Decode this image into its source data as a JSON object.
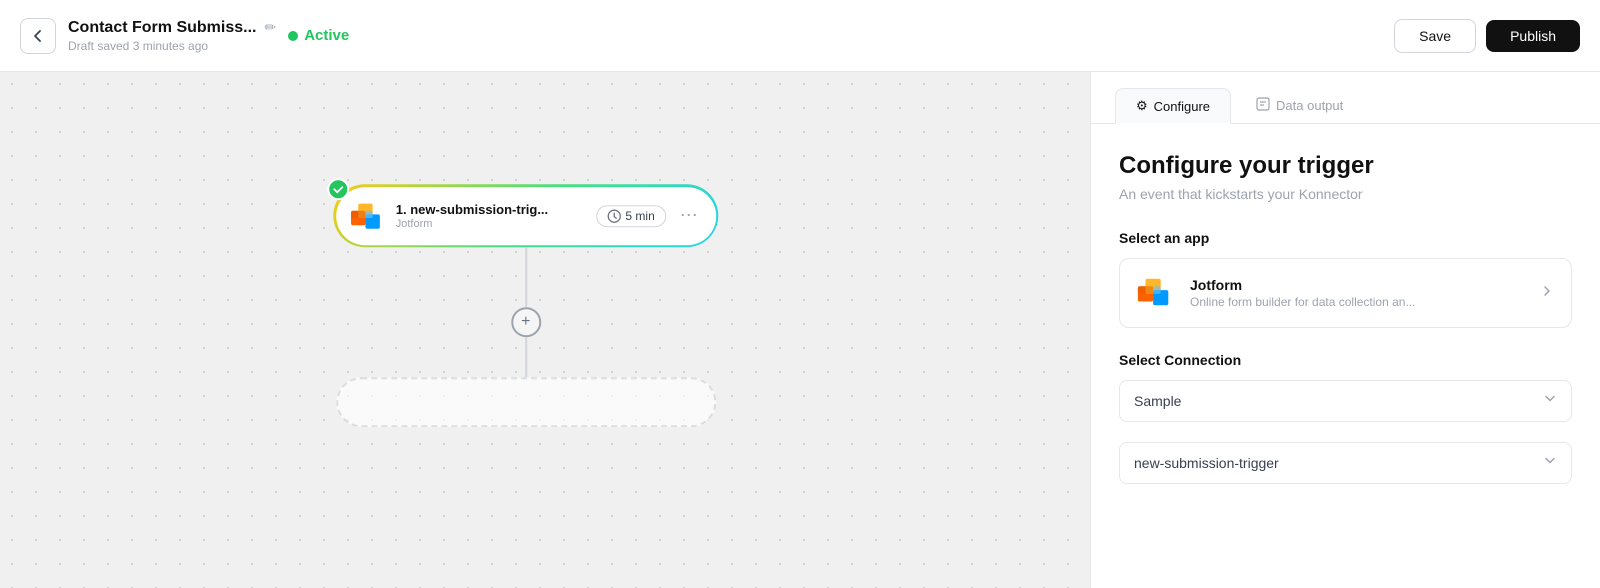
{
  "header": {
    "back_label": "←",
    "title": "Contact Form Submiss...",
    "draft_status": "Draft saved 3 minutes ago",
    "active_label": "Active",
    "save_label": "Save",
    "publish_label": "Publish"
  },
  "canvas": {
    "node": {
      "step_label": "1. new-submission-trig...",
      "app_name": "Jotform",
      "timer_label": "5 min"
    },
    "add_btn_label": "+"
  },
  "panel": {
    "tabs": [
      {
        "id": "configure",
        "label": "Configure",
        "active": true
      },
      {
        "id": "data-output",
        "label": "Data output",
        "active": false
      }
    ],
    "title": "Configure your trigger",
    "subtitle": "An event that kickstarts your Konnector",
    "select_app_label": "Select an app",
    "app": {
      "name": "Jotform",
      "description": "Online form builder for data collection an..."
    },
    "select_connection_label": "Select Connection",
    "connection_value": "Sample",
    "trigger_value": "new-submission-trigger",
    "configure_icon": "⚙",
    "data_output_icon": "📄"
  },
  "colors": {
    "active_green": "#22c55e",
    "accent_black": "#111111",
    "border_gray": "#e5e7eb"
  }
}
